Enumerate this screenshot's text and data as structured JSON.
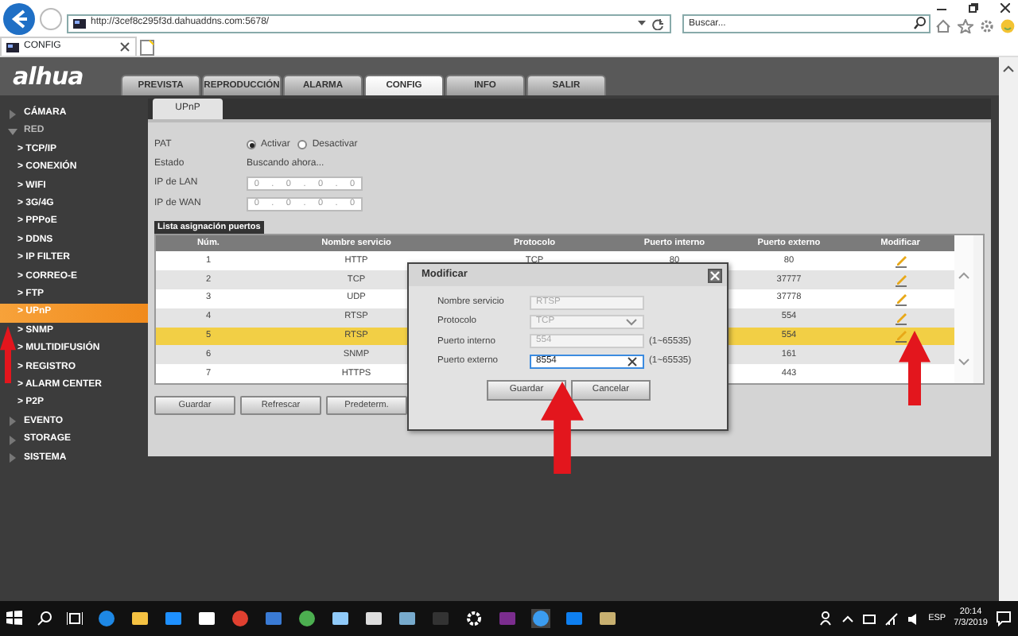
{
  "browser": {
    "address": "http://3cef8c295f3d.dahuaddns.com:5678/",
    "search": {
      "placeholder": "Buscar..."
    },
    "tabs": [
      {
        "label": "CONFIG",
        "selected": true
      }
    ]
  },
  "app": {
    "logo": "alhua",
    "nav": [
      {
        "label": "PREVISTA",
        "selected": false
      },
      {
        "label": "REPRODUCCIÓN",
        "selected": false
      },
      {
        "label": "ALARMA",
        "selected": false
      },
      {
        "label": "CONFIG",
        "selected": true
      },
      {
        "label": "INFO",
        "selected": false
      },
      {
        "label": "SALIR",
        "selected": false
      }
    ]
  },
  "sidebar": {
    "items": [
      {
        "label": "CÁMARA",
        "expanded": false
      },
      {
        "label": "RED",
        "expanded": true,
        "children": [
          {
            "label": "> TCP/IP",
            "selected": false
          },
          {
            "label": "> CONEXIÓN",
            "selected": false
          },
          {
            "label": "> WIFI",
            "selected": false
          },
          {
            "label": "> 3G/4G",
            "selected": false
          },
          {
            "label": "> PPPoE",
            "selected": false
          },
          {
            "label": "> DDNS",
            "selected": false
          },
          {
            "label": "> IP FILTER",
            "selected": false
          },
          {
            "label": "> CORREO-E",
            "selected": false
          },
          {
            "label": "> FTP",
            "selected": false
          },
          {
            "label": "> UPnP",
            "selected": true
          },
          {
            "label": "> SNMP",
            "selected": false
          },
          {
            "label": "> MULTIDIFUSIÓN",
            "selected": false
          },
          {
            "label": "> REGISTRO",
            "selected": false
          },
          {
            "label": "> ALARM CENTER",
            "selected": false
          },
          {
            "label": "> P2P",
            "selected": false
          }
        ]
      },
      {
        "label": "EVENTO",
        "expanded": false
      },
      {
        "label": "STORAGE",
        "expanded": false
      },
      {
        "label": "SISTEMA",
        "expanded": false
      }
    ]
  },
  "panel": {
    "tab": "UPnP",
    "pat": {
      "label": "PAT",
      "options": [
        {
          "label": "Activar",
          "selected": true
        },
        {
          "label": "Desactivar",
          "selected": false
        }
      ]
    },
    "status": {
      "label": "Estado",
      "value": "Buscando ahora..."
    },
    "ip_fields": [
      {
        "label": "IP de LAN",
        "octets": [
          "0",
          "0",
          "0",
          "0"
        ],
        "separator": "."
      },
      {
        "label": "IP de WAN",
        "octets": [
          "0",
          "0",
          "0",
          "0"
        ],
        "separator": "."
      }
    ],
    "table": {
      "title": "Lista asignación puertos",
      "columns": [
        "Núm.",
        "Nombre servicio",
        "Protocolo",
        "Puerto interno",
        "Puerto externo",
        "Modificar"
      ],
      "rows": [
        {
          "num": "1",
          "service": "HTTP",
          "protocol": "TCP",
          "internal": "80",
          "external": "80",
          "editable": true,
          "selected": false
        },
        {
          "num": "2",
          "service": "TCP",
          "external": "37777",
          "editable": true,
          "selected": false
        },
        {
          "num": "3",
          "service": "UDP",
          "external": "37778",
          "editable": true,
          "selected": false
        },
        {
          "num": "4",
          "service": "RTSP",
          "external": "554",
          "editable": true,
          "selected": false
        },
        {
          "num": "5",
          "service": "RTSP",
          "external": "554",
          "editable": true,
          "selected": true
        },
        {
          "num": "6",
          "service": "SNMP",
          "external": "161",
          "editable": false,
          "selected": false
        },
        {
          "num": "7",
          "service": "HTTPS",
          "external": "443",
          "editable": false,
          "selected": false
        }
      ]
    },
    "buttons": [
      "Guardar",
      "Refrescar",
      "Predeterm."
    ]
  },
  "dialog": {
    "title": "Modificar",
    "fields": [
      {
        "label": "Nombre servicio",
        "kind": "text",
        "value": "RTSP",
        "disabled": true,
        "focused": false
      },
      {
        "label": "Protocolo",
        "kind": "select",
        "value": "TCP",
        "disabled": true,
        "focused": false
      },
      {
        "label": "Puerto interno",
        "kind": "text",
        "value": "554",
        "disabled": true,
        "focused": false,
        "hint": "(1~65535)"
      },
      {
        "label": "Puerto externo",
        "kind": "text",
        "value": "8554",
        "disabled": false,
        "focused": true,
        "hint": "(1~65535)"
      }
    ],
    "buttons": [
      "Guardar",
      "Cancelar"
    ]
  },
  "taskbar": {
    "language": "ESP",
    "time": "20:14",
    "date": "7/3/2019"
  }
}
